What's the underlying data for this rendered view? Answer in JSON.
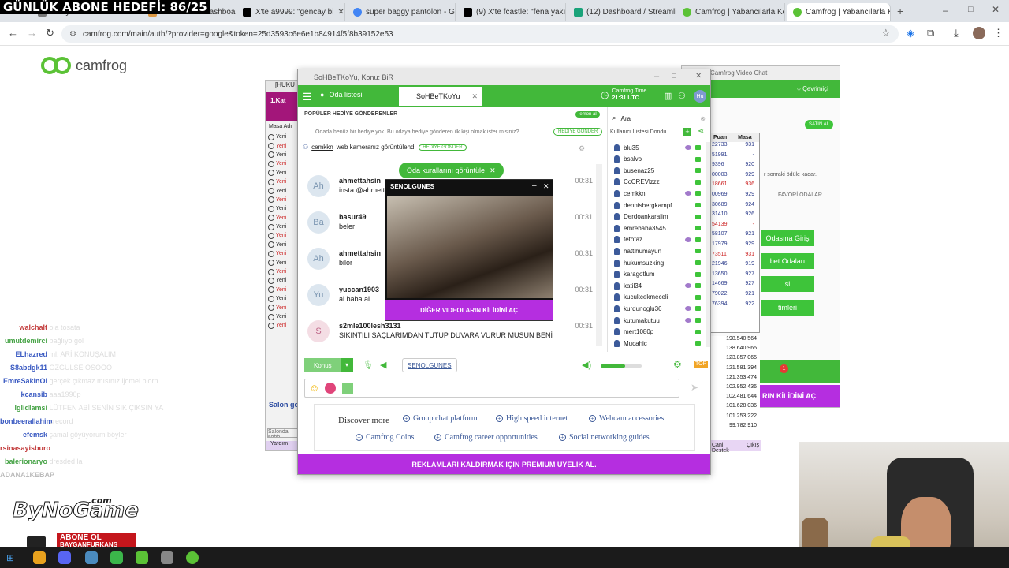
{
  "stream_headline": "GÜNLÜK ABONE HEDEFİ: 86/25",
  "browser": {
    "tabs": [
      {
        "title": "Kasiyer71"
      },
      {
        "title": "Stream - ka Dashboard"
      },
      {
        "title": "X'te a9999: \"gencay bi"
      },
      {
        "title": "süper baggy pantolon - G"
      },
      {
        "title": "(9) X'te fcastle: \"fena yakı"
      },
      {
        "title": "(12) Dashboard / Streamli"
      },
      {
        "title": "Camfrog | Yabancılarla Ko"
      },
      {
        "title": "Camfrog | Yabancılarla Ko"
      }
    ],
    "url": "camfrog.com/main/auth/?provider=google&token=25d3593c6e6e1b84914f5f8b39152e53"
  },
  "logo_text": "camfrog",
  "main_window": {
    "title": "SoHBeTKoYu, Konu: BiR",
    "room_list_tab": "Oda listesi",
    "room_tab": "SoHBeTKoYu",
    "camfrog_time_label": "Camfrog Time",
    "camfrog_time_value": "21:31 UTC",
    "popular_gift_header": "POPÜLER HEDİYE GÖNDERENLER",
    "gift_link": "lemon al",
    "gift_prompt": "Odada henüz bir hediye yok. Bu odaya hediye gönderen ilk kişi olmak ister misiniz?",
    "send_gift_button": "HEDİYE GÖNDER",
    "cam_notice_user": "cemkkn",
    "cam_notice_text": "web kameranız görüntülendi",
    "cam_notice_button": "HEDİYE GÖNDER",
    "rules_pill": "Oda kurallarını görüntüle",
    "messages": [
      {
        "initials": "Ah",
        "name": "ahmettahsin",
        "text": "insta @ahmettahsin",
        "time": "00:31"
      },
      {
        "initials": "Ba",
        "name": "basur49",
        "text": "beler",
        "time": "00:31"
      },
      {
        "initials": "Ah",
        "name": "ahmettahsin",
        "text": "bilor",
        "time": "00:31"
      },
      {
        "initials": "Yu",
        "name": "yuccan1903",
        "text": "al baba al",
        "time": "00:31"
      },
      {
        "initials": "S",
        "name": "s2mle100lesh3131",
        "text": "SIKINTILI SAÇLARIMDAN TUTUP  DUVARA VURUR MUSUN BENİ",
        "time": "00:31"
      }
    ],
    "video_window": {
      "title": "SENOLGUNES",
      "unlock_button": "DİĞER VIDEOLARIN KİLİDİNİ AÇ"
    },
    "talk_button": "Konuş",
    "viewing_user": "SENOLGUNES",
    "search_placeholder": "Ara",
    "user_list_label": "Kullanıcı Listesi Dondu...",
    "users": [
      "blu35",
      "bsalvo",
      "busenaz25",
      "CcCREVlzzz",
      "cemkkn",
      "dennisbergkampf",
      "Derdoankaralim",
      "emrebaba3545",
      "fetofaz",
      "hattihumayun",
      "hukumsuzking",
      "karagotlum",
      "katil34",
      "kucukcekmeceli",
      "kurdunoglu36",
      "kutumakutuu",
      "mert1080p",
      "Mucahic"
    ],
    "discover_label": "Discover more",
    "discover_links": [
      "Group chat platform",
      "High speed internet",
      "Webcam accessories",
      "Camfrog Coins",
      "Camfrog career opportunities",
      "Social networking guides"
    ],
    "premium_banner": "REKLAMLARI KALDIRMAK İÇİN PREMIUM ÜYELİK AL."
  },
  "right_window": {
    "title": "Camfrog Video Chat",
    "status": "Çevrimiçi",
    "buy_button": "SATIN AL",
    "reward_text": "r sonraki ödüle kadar.",
    "fav_rooms": "FAVORİ ODALAR",
    "green_buttons": [
      "Odasına Giriş",
      "bet Odaları",
      "si",
      "timleri"
    ],
    "unlock_banner": "RIN KİLİDİNİ AÇ",
    "notification_count": "1"
  },
  "left_window": {
    "title": "[HUKU",
    "floor": "1.Kat",
    "table_header": "Masa Adı",
    "row_label": "Yeni",
    "bottom_label": "Salon ge",
    "bottom_buttons": [
      "Yardım",
      "Canlı Destek",
      "Çıkış"
    ],
    "search_placeholder": "Salonda sohb"
  },
  "score_table": {
    "headers": [
      "Puan",
      "Masa"
    ],
    "rows": [
      [
        "22733",
        "931"
      ],
      [
        "51991",
        "-"
      ],
      [
        "9396",
        "920"
      ],
      [
        "00003",
        "929"
      ],
      [
        "18661",
        "936"
      ],
      [
        "00969",
        "929"
      ],
      [
        "30689",
        "924"
      ],
      [
        "31410",
        "926"
      ],
      [
        "54139",
        "-"
      ],
      [
        "58107",
        "921"
      ],
      [
        "17979",
        "929"
      ],
      [
        "73511",
        "931"
      ],
      [
        "21946",
        "919"
      ],
      [
        "13650",
        "927"
      ],
      [
        "14669",
        "927"
      ],
      [
        "79022",
        "921"
      ],
      [
        "76394",
        "922"
      ]
    ],
    "puan_list": [
      "198.540.564",
      "138.640.965",
      "123.857.065",
      "121.581.394",
      "121.353.474",
      "102.952.436",
      "102.481.644",
      "101.628.036",
      "101.253.222",
      "99.782.910"
    ]
  },
  "stream_chat": [
    {
      "user": "walchalt",
      "text": "ola tosata",
      "color": "#c23a3a"
    },
    {
      "user": "umutdemirci",
      "text": "bağlıyo gol",
      "color": "#44a244"
    },
    {
      "user": "ELhazred",
      "text": "ml. ARİ KONUŞALIM",
      "color": "#3a5ac2"
    },
    {
      "user": "S8abdgk11",
      "text": "ÖZGÜLSE OSOOO",
      "color": "#3a5ac2"
    },
    {
      "user": "EmreSakinOl",
      "text": "gerçek çıkmaz mısınız ljomel biorn",
      "color": "#3a5ac2"
    },
    {
      "user": "kcansib",
      "text": "aaa1990p",
      "color": "#3a5ac2"
    },
    {
      "user": "lglidlamsi",
      "text": "LÜTFEN ABİ SENİN SIK ÇIKSIN YA",
      "color": "#44a244"
    },
    {
      "user": "bonbeerallahim",
      "text": "crecord",
      "color": "#3a5ac2"
    },
    {
      "user": "efemsk",
      "text": "şamal göyüyorum böyler",
      "color": "#3a5ac2"
    },
    {
      "user": "rsinasayisburo",
      "text": "",
      "color": "#c23a3a"
    },
    {
      "user": "balerionaryo",
      "text": "dresded la",
      "color": "#44a244"
    },
    {
      "user": "ADANA1KEBAP",
      "text": "",
      "color": "#bbbbbb"
    }
  ],
  "branding": {
    "bynogame": "ByNoGame",
    "dotcom": ".com",
    "abone": "ABONE OL",
    "handle": "BAYGANFURKANS"
  },
  "colors": {
    "accent_green": "#42b83a",
    "purple": "#b52ee0",
    "link_blue": "#3b5998"
  }
}
